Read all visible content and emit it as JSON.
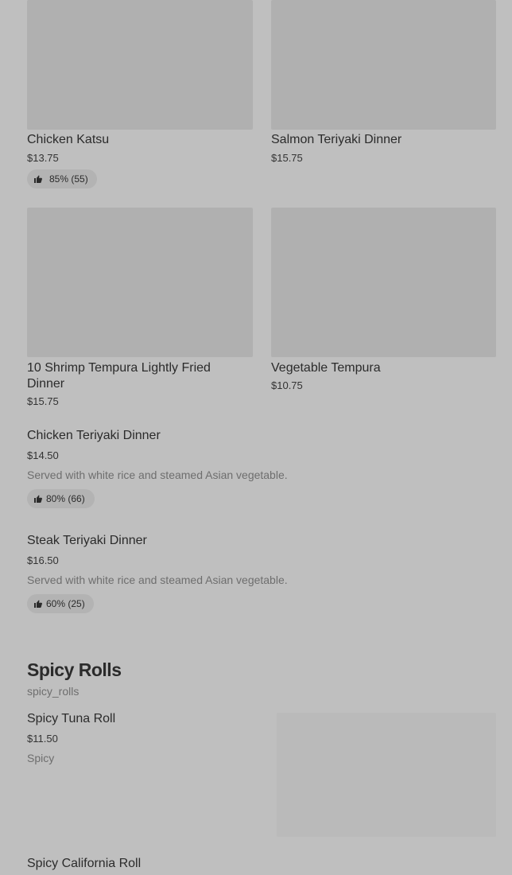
{
  "items": [
    {
      "name": "Chicken Katsu",
      "price": "$13.75",
      "rating": "85% (55)"
    },
    {
      "name": "Salmon Teriyaki Dinner",
      "price": "$15.75"
    },
    {
      "name": "10 Shrimp Tempura Lightly Fried Dinner",
      "price": "$15.75"
    },
    {
      "name": "Vegetable Tempura",
      "price": "$10.75"
    },
    {
      "name": "Chicken Teriyaki Dinner",
      "price": "$14.50",
      "description": "Served with white rice and steamed Asian vegetable.",
      "rating": "80% (66)"
    },
    {
      "name": "Steak Teriyaki Dinner",
      "price": "$16.50",
      "description": "Served with white rice and steamed Asian vegetable.",
      "rating": "60% (25)"
    }
  ],
  "spicy_section": {
    "title": "Spicy Rolls",
    "id": "spicy_rolls",
    "items": [
      {
        "name": "Spicy Tuna Roll",
        "price": "$11.50",
        "description": "Spicy"
      },
      {
        "name": "Spicy California Roll"
      }
    ]
  },
  "icons": {
    "rating": "thumbs-up-icon"
  },
  "colors": {
    "background": "#bfbfbf",
    "image_placeholder": "#b0b0b0",
    "pill": "#b3b3b3"
  }
}
